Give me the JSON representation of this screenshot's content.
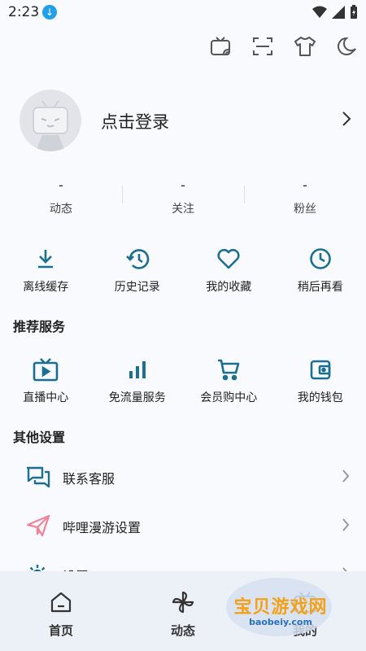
{
  "status_bar": {
    "time": "2:23"
  },
  "profile": {
    "login_label": "点击登录"
  },
  "stats": [
    {
      "value": "-",
      "label": "动态"
    },
    {
      "value": "-",
      "label": "关注"
    },
    {
      "value": "-",
      "label": "粉丝"
    }
  ],
  "quick_actions": [
    {
      "label": "离线缓存",
      "icon": "download-icon"
    },
    {
      "label": "历史记录",
      "icon": "history-icon"
    },
    {
      "label": "我的收藏",
      "icon": "heart-icon"
    },
    {
      "label": "稍后再看",
      "icon": "clock-icon"
    }
  ],
  "recommended": {
    "title": "推荐服务",
    "items": [
      {
        "label": "直播中心",
        "icon": "tv-play-icon"
      },
      {
        "label": "免流量服务",
        "icon": "signal-bars-icon"
      },
      {
        "label": "会员购中心",
        "icon": "cart-icon"
      },
      {
        "label": "我的钱包",
        "icon": "wallet-icon"
      }
    ]
  },
  "other_settings": {
    "title": "其他设置",
    "items": [
      {
        "label": "联系客服",
        "icon": "chat-icon"
      },
      {
        "label": "哔哩漫游设置",
        "icon": "paper-plane-icon"
      },
      {
        "label": "设置",
        "icon": "gear-icon"
      }
    ]
  },
  "bottom_nav": [
    {
      "label": "首页",
      "icon": "home-icon"
    },
    {
      "label": "动态",
      "icon": "pinwheel-icon"
    },
    {
      "label": "我的",
      "icon": "tv-icon"
    }
  ],
  "watermark": {
    "title": "宝贝游戏网",
    "url": "baobeiy.com"
  },
  "colors": {
    "accent": "#1b6f8f",
    "background": "#f8fafd",
    "nav_bg": "#ecf1f8"
  }
}
